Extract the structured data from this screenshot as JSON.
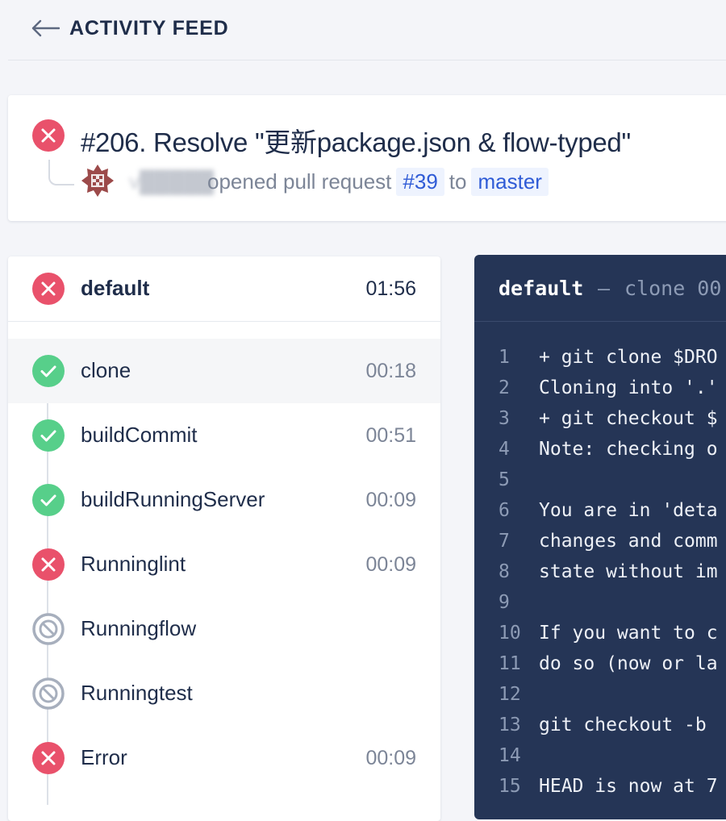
{
  "header": {
    "title": "ACTIVITY FEED",
    "back_icon": "arrow-left-icon"
  },
  "pr": {
    "status": "failure",
    "title": "#206. Resolve \"更新package.json & flow-typed\"",
    "user": "v█████",
    "action": "opened pull request",
    "pr_number": "#39",
    "to": "to",
    "branch": "master"
  },
  "pipeline": {
    "name": "default",
    "status": "failure",
    "time": "01:56",
    "steps": [
      {
        "name": "clone",
        "status": "success",
        "time": "00:18",
        "selected": true
      },
      {
        "name": "buildCommit",
        "status": "success",
        "time": "00:51"
      },
      {
        "name": "buildRunningServer",
        "status": "success",
        "time": "00:09"
      },
      {
        "name": "Runninglint",
        "status": "failure",
        "time": "00:09"
      },
      {
        "name": "Runningflow",
        "status": "skipped",
        "time": ""
      },
      {
        "name": "Runningtest",
        "status": "skipped",
        "time": ""
      },
      {
        "name": "Error",
        "status": "failure",
        "time": "00:09"
      }
    ]
  },
  "log": {
    "header": {
      "pipeline": "default",
      "sep": "—",
      "step": "clone 00"
    },
    "lines": [
      {
        "n": "1",
        "text": "+ git clone $DRO"
      },
      {
        "n": "2",
        "text": "Cloning into '.'"
      },
      {
        "n": "3",
        "text": "+ git checkout $"
      },
      {
        "n": "4",
        "text": "Note: checking o"
      },
      {
        "n": "5",
        "text": ""
      },
      {
        "n": "6",
        "text": "You are in 'deta"
      },
      {
        "n": "7",
        "text": "changes and comm"
      },
      {
        "n": "8",
        "text": "state without im"
      },
      {
        "n": "9",
        "text": ""
      },
      {
        "n": "10",
        "text": "If you want to c"
      },
      {
        "n": "11",
        "text": "do so (now or la"
      },
      {
        "n": "12",
        "text": ""
      },
      {
        "n": "13",
        "text": "git checkout -b"
      },
      {
        "n": "14",
        "text": ""
      },
      {
        "n": "15",
        "text": "HEAD is now at 7"
      }
    ]
  },
  "colors": {
    "failure": "#e9516b",
    "success": "#57cf8a",
    "skipped": "#a7afbd",
    "log_bg": "#253556",
    "link": "#2f5bd6"
  }
}
